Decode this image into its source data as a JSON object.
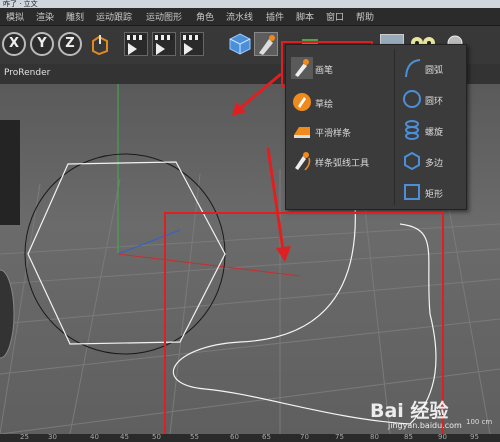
{
  "title_fragment": "咋了 · 立文",
  "menu": [
    "模拟",
    "渲染",
    "雕刻",
    "运动跟踪",
    "运动图形",
    "角色",
    "流水线",
    "插件",
    "脚本",
    "窗口",
    "帮助"
  ],
  "toolbar": {
    "axis_buttons": [
      "X",
      "Y",
      "Z"
    ]
  },
  "viewport": {
    "header_label": "ProRender"
  },
  "spline_menu": {
    "left_items": [
      {
        "label": "画笔",
        "icon": "pen-tool-icon"
      },
      {
        "label": "草绘",
        "icon": "sketch-pen-icon"
      },
      {
        "label": "平滑样条",
        "icon": "smooth-spline-iron-icon"
      },
      {
        "label": "样条弧线工具",
        "icon": "spline-arc-tool-icon"
      }
    ],
    "right_items": [
      {
        "label": "圆弧",
        "icon": "arc-icon"
      },
      {
        "label": "圆环",
        "icon": "circle-icon"
      },
      {
        "label": "螺旋",
        "icon": "helix-icon"
      },
      {
        "label": "多边",
        "icon": "polygon-icon"
      },
      {
        "label": "矩形",
        "icon": "rectangle-icon"
      }
    ]
  },
  "ruler": [
    "25",
    "30",
    "40",
    "45",
    "50",
    "55",
    "60",
    "65",
    "70",
    "75",
    "80",
    "85",
    "90",
    "95"
  ],
  "status_value": "100 cm",
  "watermark": {
    "text": "Bai 经验",
    "url": "jingyan.baidu.com"
  },
  "colors": {
    "annotation_red": "#e02020",
    "accent_orange": "#f08a1c",
    "accent_blue": "#4a8fd8"
  }
}
